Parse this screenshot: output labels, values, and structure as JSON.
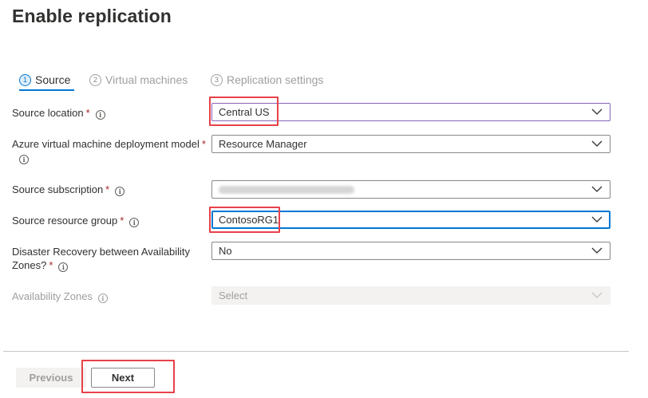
{
  "page": {
    "title": "Enable replication"
  },
  "steps": [
    {
      "number": "1",
      "label": "Source",
      "active": true
    },
    {
      "number": "2",
      "label": "Virtual machines",
      "active": false
    },
    {
      "number": "3",
      "label": "Replication settings",
      "active": false
    }
  ],
  "form": {
    "source_location": {
      "label": "Source location",
      "required": "*",
      "value": "Central US"
    },
    "deployment_model": {
      "label": "Azure virtual machine deployment model",
      "required": "*",
      "value": "Resource Manager"
    },
    "source_subscription": {
      "label": "Source subscription",
      "required": "*",
      "value": ""
    },
    "source_resource_group": {
      "label": "Source resource group",
      "required": "*",
      "value": "ContosoRG1"
    },
    "dr_zones": {
      "label_line1": "Disaster Recovery between Availability",
      "label_line2": "Zones?",
      "required": "*",
      "value": "No"
    },
    "availability_zones": {
      "label": "Availability Zones",
      "placeholder": "Select",
      "disabled": true
    }
  },
  "footer": {
    "previous_label": "Previous",
    "next_label": "Next"
  },
  "icons": {
    "info": "info-icon",
    "dropdown": "chevron-down-icon"
  },
  "colors": {
    "accent": "#0078d4",
    "required": "#a4262c",
    "highlight": "#e8414a"
  }
}
